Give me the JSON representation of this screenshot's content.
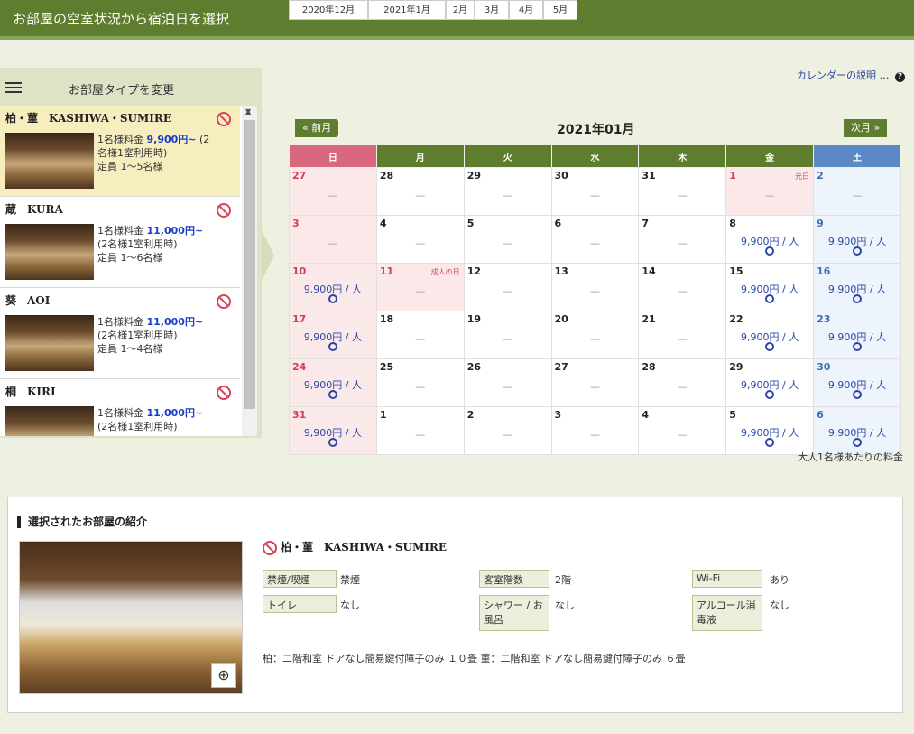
{
  "header": {
    "title": "お部屋の空室状況から宿泊日を選択"
  },
  "help": {
    "link": "カレンダーの説明",
    "dots": "…"
  },
  "left": {
    "title": "お部屋タイプを変更",
    "rooms": [
      {
        "name": "柏・菫　KASHIWA・SUMIRE",
        "line1": "1名様料金",
        "price": "9,900円~",
        "line1b": "(2",
        "line2": "名様1室利用時)",
        "line3": "定員 1～5名様"
      },
      {
        "name": "蔵　KURA",
        "line1": "1名様料金",
        "price": "11,000円~",
        "line2": "(2名様1室利用時)",
        "line3": "定員 1～6名様"
      },
      {
        "name": "葵　AOI",
        "line1": "1名様料金",
        "price": "11,000円~",
        "line2": "(2名様1室利用時)",
        "line3": "定員 1～4名様"
      },
      {
        "name": "桐　KIRI",
        "line1": "1名様料金",
        "price": "11,000円~",
        "line2": "(2名様1室利用時)"
      }
    ]
  },
  "calendar": {
    "tabs": [
      "2020年12月",
      "2021年1月",
      "2月",
      "3月",
      "4月",
      "5月"
    ],
    "prev": "« 前月",
    "next": "次月 »",
    "month": "2021年01月",
    "weekdays": [
      "日",
      "月",
      "火",
      "水",
      "木",
      "金",
      "土"
    ],
    "price": "9,900円 / 人",
    "none": "—",
    "weeks": [
      [
        {
          "d": "27",
          "t": "sun"
        },
        {
          "d": "28"
        },
        {
          "d": "29"
        },
        {
          "d": "30"
        },
        {
          "d": "31"
        },
        {
          "d": "1",
          "t": "hol",
          "h": "元日"
        },
        {
          "d": "2",
          "t": "sat"
        }
      ],
      [
        {
          "d": "3",
          "t": "sun"
        },
        {
          "d": "4"
        },
        {
          "d": "5"
        },
        {
          "d": "6"
        },
        {
          "d": "7"
        },
        {
          "d": "8",
          "a": 1
        },
        {
          "d": "9",
          "t": "sat",
          "a": 1
        }
      ],
      [
        {
          "d": "10",
          "t": "sun",
          "a": 1
        },
        {
          "d": "11",
          "t": "hol",
          "h": "成人の日"
        },
        {
          "d": "12"
        },
        {
          "d": "13"
        },
        {
          "d": "14"
        },
        {
          "d": "15",
          "a": 1
        },
        {
          "d": "16",
          "t": "sat",
          "a": 1
        }
      ],
      [
        {
          "d": "17",
          "t": "sun",
          "a": 1
        },
        {
          "d": "18"
        },
        {
          "d": "19"
        },
        {
          "d": "20"
        },
        {
          "d": "21"
        },
        {
          "d": "22",
          "a": 1
        },
        {
          "d": "23",
          "t": "sat",
          "a": 1
        }
      ],
      [
        {
          "d": "24",
          "t": "sun",
          "a": 1
        },
        {
          "d": "25"
        },
        {
          "d": "26"
        },
        {
          "d": "27"
        },
        {
          "d": "28"
        },
        {
          "d": "29",
          "a": 1
        },
        {
          "d": "30",
          "t": "sat",
          "a": 1
        }
      ],
      [
        {
          "d": "31",
          "t": "sun",
          "a": 1
        },
        {
          "d": "1"
        },
        {
          "d": "2"
        },
        {
          "d": "3"
        },
        {
          "d": "4"
        },
        {
          "d": "5",
          "a": 1
        },
        {
          "d": "6",
          "t": "sat",
          "a": 1
        }
      ]
    ],
    "note": "大人1名様あたりの料金"
  },
  "selected": {
    "section": "選択されたお部屋の紹介",
    "name": "柏・菫　KASHIWA・SUMIRE",
    "labels": {
      "smoking": "禁煙/喫煙",
      "floor": "客室階数",
      "wifi": "Wi-Fi",
      "toilet": "トイレ",
      "shower": "シャワー / お風呂",
      "alcohol": "アルコール消毒液"
    },
    "values": {
      "smoking": "禁煙",
      "floor": "2階",
      "wifi": "あり",
      "toilet": "なし",
      "shower": "なし",
      "alcohol": "なし"
    },
    "desc": "柏：二階和室 ドアなし簡易鍵付障子のみ １０畳 菫：二階和室 ドアなし簡易鍵付障子のみ ６畳"
  },
  "colors": {
    "brand": "#5e7d2e",
    "sunday": "#d9687f",
    "saturday": "#5b88c6",
    "price": "#2a46a8"
  }
}
